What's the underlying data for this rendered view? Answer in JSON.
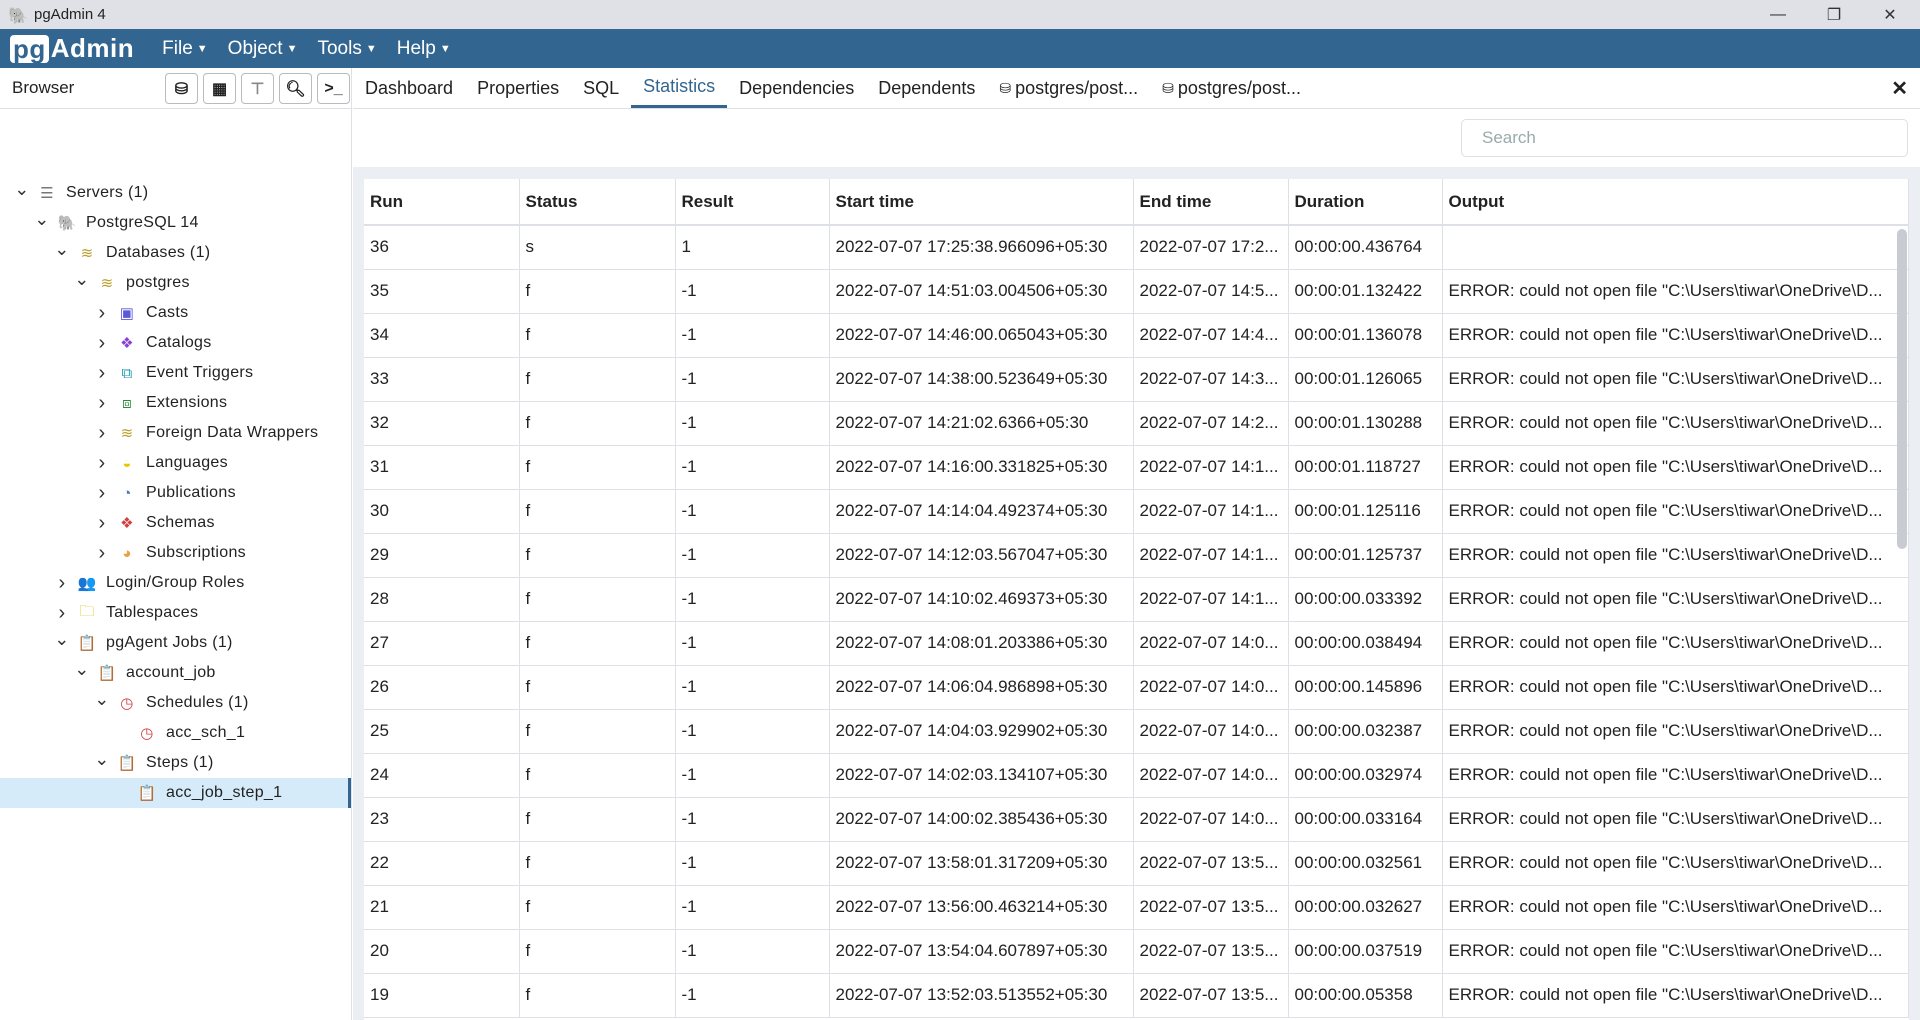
{
  "window": {
    "title": "pgAdmin 4",
    "controls": [
      "minimize-icon",
      "restore-icon",
      "close-icon"
    ]
  },
  "menubar": {
    "brand_pg": "pg",
    "brand_rest": "Admin",
    "menus": [
      "File",
      "Object",
      "Tools",
      "Help"
    ]
  },
  "browser": {
    "title": "Browser",
    "tools": [
      "query-tool-icon",
      "view-data-icon",
      "filtered-rows-icon",
      "search-objects-icon",
      "psql-tool-icon"
    ],
    "tree": [
      {
        "label": "Servers (1)",
        "level": 0,
        "toggle": "open",
        "icon": "servers-icon",
        "glyph": "☰",
        "color": "#777"
      },
      {
        "label": "PostgreSQL 14",
        "level": 1,
        "toggle": "open",
        "icon": "postgres-elephant-icon",
        "glyph": "🐘",
        "color": "#336791"
      },
      {
        "label": "Databases (1)",
        "level": 2,
        "toggle": "open",
        "icon": "databases-icon",
        "glyph": "≋",
        "color": "#b8a030"
      },
      {
        "label": "postgres",
        "level": 3,
        "toggle": "open",
        "icon": "database-icon",
        "glyph": "≋",
        "color": "#b8a030"
      },
      {
        "label": "Casts",
        "level": 4,
        "toggle": "closed",
        "icon": "casts-icon",
        "glyph": "▣",
        "color": "#5a5ad6"
      },
      {
        "label": "Catalogs",
        "level": 4,
        "toggle": "closed",
        "icon": "catalogs-icon",
        "glyph": "❖",
        "color": "#8a40d0"
      },
      {
        "label": "Event Triggers",
        "level": 4,
        "toggle": "closed",
        "icon": "event-triggers-icon",
        "glyph": "⧉",
        "color": "#1a9ab0"
      },
      {
        "label": "Extensions",
        "level": 4,
        "toggle": "closed",
        "icon": "extensions-icon",
        "glyph": "⧈",
        "color": "#2a8a3a"
      },
      {
        "label": "Foreign Data Wrappers",
        "level": 4,
        "toggle": "closed",
        "icon": "foreign-data-wrappers-icon",
        "glyph": "≋",
        "color": "#b8a030"
      },
      {
        "label": "Languages",
        "level": 4,
        "toggle": "closed",
        "icon": "languages-icon",
        "glyph": "◒",
        "color": "#e8c800"
      },
      {
        "label": "Publications",
        "level": 4,
        "toggle": "closed",
        "icon": "publications-icon",
        "glyph": "◔",
        "color": "#5070c0"
      },
      {
        "label": "Schemas",
        "level": 4,
        "toggle": "closed",
        "icon": "schemas-icon",
        "glyph": "❖",
        "color": "#d04040"
      },
      {
        "label": "Subscriptions",
        "level": 4,
        "toggle": "closed",
        "icon": "subscriptions-icon",
        "glyph": "◕",
        "color": "#e8a040"
      },
      {
        "label": "Login/Group Roles",
        "level": 2,
        "toggle": "closed",
        "icon": "login-group-roles-icon",
        "glyph": "👥",
        "color": "#d04040"
      },
      {
        "label": "Tablespaces",
        "level": 2,
        "toggle": "closed",
        "icon": "tablespaces-icon",
        "glyph": "🗀",
        "color": "#d8b800"
      },
      {
        "label": "pgAgent Jobs (1)",
        "level": 2,
        "toggle": "open",
        "icon": "pgagent-jobs-icon",
        "glyph": "📋",
        "color": "#3a6aa0"
      },
      {
        "label": "account_job",
        "level": 3,
        "toggle": "open",
        "icon": "job-icon",
        "glyph": "📋",
        "color": "#3a6aa0"
      },
      {
        "label": "Schedules (1)",
        "level": 4,
        "toggle": "open",
        "icon": "schedules-icon",
        "glyph": "◷",
        "color": "#d04040"
      },
      {
        "label": "acc_sch_1",
        "level": 5,
        "toggle": "none",
        "icon": "schedule-clock-icon",
        "glyph": "◷",
        "color": "#d04040"
      },
      {
        "label": "Steps (1)",
        "level": 4,
        "toggle": "open",
        "icon": "steps-icon",
        "glyph": "📋",
        "color": "#3a6aa0"
      },
      {
        "label": "acc_job_step_1",
        "level": 5,
        "toggle": "none",
        "icon": "step-icon",
        "glyph": "📋",
        "color": "#3a6aa0",
        "selected": true
      }
    ]
  },
  "tabs": [
    {
      "label": "Dashboard"
    },
    {
      "label": "Properties"
    },
    {
      "label": "SQL"
    },
    {
      "label": "Statistics",
      "active": true
    },
    {
      "label": "Dependencies"
    },
    {
      "label": "Dependents"
    },
    {
      "label": "postgres/post...",
      "icon": "query-tool-icon"
    },
    {
      "label": "postgres/post...",
      "icon": "query-tool-icon"
    }
  ],
  "close_label": "✕",
  "search": {
    "placeholder": "Search",
    "value": ""
  },
  "table": {
    "columns": [
      "Run",
      "Status",
      "Result",
      "Start time",
      "End time",
      "Duration",
      "Output"
    ],
    "rows": [
      [
        "36",
        "s",
        "1",
        "2022-07-07 17:25:38.966096+05:30",
        "2022-07-07 17:2...",
        "00:00:00.436764",
        ""
      ],
      [
        "35",
        "f",
        "-1",
        "2022-07-07 14:51:03.004506+05:30",
        "2022-07-07 14:5...",
        "00:00:01.132422",
        "ERROR: could not open file \"C:\\Users\\tiwar\\OneDrive\\D..."
      ],
      [
        "34",
        "f",
        "-1",
        "2022-07-07 14:46:00.065043+05:30",
        "2022-07-07 14:4...",
        "00:00:01.136078",
        "ERROR: could not open file \"C:\\Users\\tiwar\\OneDrive\\D..."
      ],
      [
        "33",
        "f",
        "-1",
        "2022-07-07 14:38:00.523649+05:30",
        "2022-07-07 14:3...",
        "00:00:01.126065",
        "ERROR: could not open file \"C:\\Users\\tiwar\\OneDrive\\D..."
      ],
      [
        "32",
        "f",
        "-1",
        "2022-07-07 14:21:02.6366+05:30",
        "2022-07-07 14:2...",
        "00:00:01.130288",
        "ERROR: could not open file \"C:\\Users\\tiwar\\OneDrive\\D..."
      ],
      [
        "31",
        "f",
        "-1",
        "2022-07-07 14:16:00.331825+05:30",
        "2022-07-07 14:1...",
        "00:00:01.118727",
        "ERROR: could not open file \"C:\\Users\\tiwar\\OneDrive\\D..."
      ],
      [
        "30",
        "f",
        "-1",
        "2022-07-07 14:14:04.492374+05:30",
        "2022-07-07 14:1...",
        "00:00:01.125116",
        "ERROR: could not open file \"C:\\Users\\tiwar\\OneDrive\\D..."
      ],
      [
        "29",
        "f",
        "-1",
        "2022-07-07 14:12:03.567047+05:30",
        "2022-07-07 14:1...",
        "00:00:01.125737",
        "ERROR: could not open file \"C:\\Users\\tiwar\\OneDrive\\D..."
      ],
      [
        "28",
        "f",
        "-1",
        "2022-07-07 14:10:02.469373+05:30",
        "2022-07-07 14:1...",
        "00:00:00.033392",
        "ERROR: could not open file \"C:\\Users\\tiwar\\OneDrive\\D..."
      ],
      [
        "27",
        "f",
        "-1",
        "2022-07-07 14:08:01.203386+05:30",
        "2022-07-07 14:0...",
        "00:00:00.038494",
        "ERROR: could not open file \"C:\\Users\\tiwar\\OneDrive\\D..."
      ],
      [
        "26",
        "f",
        "-1",
        "2022-07-07 14:06:04.986898+05:30",
        "2022-07-07 14:0...",
        "00:00:00.145896",
        "ERROR: could not open file \"C:\\Users\\tiwar\\OneDrive\\D..."
      ],
      [
        "25",
        "f",
        "-1",
        "2022-07-07 14:04:03.929902+05:30",
        "2022-07-07 14:0...",
        "00:00:00.032387",
        "ERROR: could not open file \"C:\\Users\\tiwar\\OneDrive\\D..."
      ],
      [
        "24",
        "f",
        "-1",
        "2022-07-07 14:02:03.134107+05:30",
        "2022-07-07 14:0...",
        "00:00:00.032974",
        "ERROR: could not open file \"C:\\Users\\tiwar\\OneDrive\\D..."
      ],
      [
        "23",
        "f",
        "-1",
        "2022-07-07 14:00:02.385436+05:30",
        "2022-07-07 14:0...",
        "00:00:00.033164",
        "ERROR: could not open file \"C:\\Users\\tiwar\\OneDrive\\D..."
      ],
      [
        "22",
        "f",
        "-1",
        "2022-07-07 13:58:01.317209+05:30",
        "2022-07-07 13:5...",
        "00:00:00.032561",
        "ERROR: could not open file \"C:\\Users\\tiwar\\OneDrive\\D..."
      ],
      [
        "21",
        "f",
        "-1",
        "2022-07-07 13:56:00.463214+05:30",
        "2022-07-07 13:5...",
        "00:00:00.032627",
        "ERROR: could not open file \"C:\\Users\\tiwar\\OneDrive\\D..."
      ],
      [
        "20",
        "f",
        "-1",
        "2022-07-07 13:54:04.607897+05:30",
        "2022-07-07 13:5...",
        "00:00:00.037519",
        "ERROR: could not open file \"C:\\Users\\tiwar\\OneDrive\\D..."
      ],
      [
        "19",
        "f",
        "-1",
        "2022-07-07 13:52:03.513552+05:30",
        "2022-07-07 13:5...",
        "00:00:00.05358",
        "ERROR: could not open file \"C:\\Users\\tiwar\\OneDrive\\D..."
      ]
    ]
  },
  "colors": {
    "menubar": "#326690",
    "accent": "#326690",
    "selected_row": "#d6ebfa"
  }
}
